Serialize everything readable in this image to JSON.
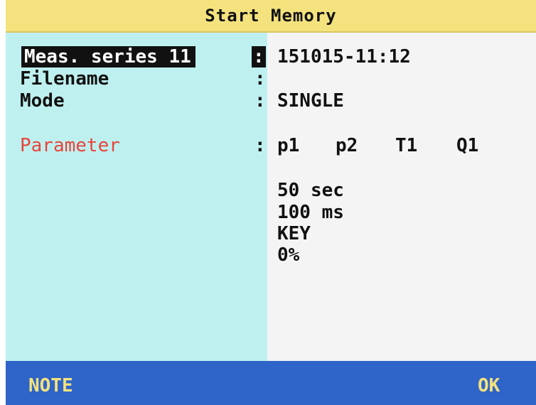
{
  "title": "Start Memory",
  "fields": {
    "meas_series_label": "Meas. series 11",
    "meas_series_colon": ":",
    "meas_series_value": "151015-11:12",
    "filename_label": "Filename",
    "filename_colon": ":",
    "mode_label": "Mode",
    "mode_colon": ":",
    "mode_value": "SINGLE",
    "parameter_label": "Parameter",
    "parameter_colon": ":",
    "parameters": [
      "p1",
      "p2",
      "T1",
      "Q1"
    ]
  },
  "settings": {
    "duration": "50 sec",
    "interval": "100 ms",
    "trigger": "KEY",
    "progress": "0%"
  },
  "footer": {
    "left_softkey": "NOTE",
    "right_softkey": "OK"
  },
  "colors": {
    "title_bg": "#f4e27e",
    "left_bg": "#bff0f0",
    "right_bg": "#f4f4f4",
    "footer_bg": "#2f64c8",
    "softkey_text": "#f4e27e",
    "parameter_label": "#e8443a"
  }
}
